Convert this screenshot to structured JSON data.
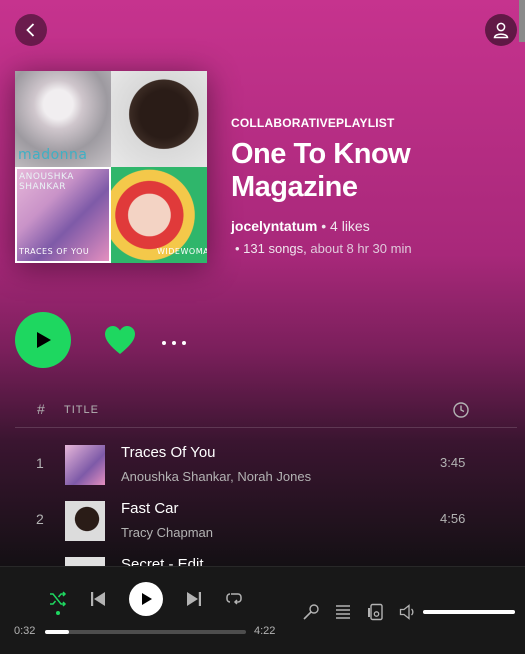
{
  "playlist": {
    "type_label": "COLLABORATIVEPLAYLIST",
    "title": "One To Know Magazine",
    "owner": "jocelyntatum",
    "likes": " • 4 likes",
    "song_count": "• 131 songs,",
    "duration": " about 8 hr 30 min"
  },
  "cover": {
    "tile1_text": "madonna",
    "tile3_text_top": "ANOUSHKA SHANKAR",
    "tile3_text_bottom": "TRACES OF YOU",
    "tile4_text": "WIDEWOMAN"
  },
  "table": {
    "num_header": "#",
    "title_header": "TITLE"
  },
  "tracks": [
    {
      "num": "1",
      "title": "Traces Of You",
      "artist": "Anoushka Shankar, Norah Jones",
      "duration": "3:45"
    },
    {
      "num": "2",
      "title": "Fast Car",
      "artist": "Tracy Chapman",
      "duration": "4:56"
    },
    {
      "num": "3",
      "title": "Secret - Edit",
      "artist": "",
      "duration": ""
    }
  ],
  "player": {
    "current_time": "0:32",
    "total_time": "4:22",
    "progress_fraction": 0.12,
    "volume_fraction": 1.0
  },
  "colors": {
    "accent": "#1ed760",
    "header_gradient_top": "#c6338e"
  },
  "icons": {
    "back": "chevron-left-icon",
    "user": "user-icon",
    "play": "play-icon",
    "heart": "heart-icon",
    "more": "more-icon",
    "clock": "clock-icon",
    "shuffle": "shuffle-icon",
    "prev": "skip-back-icon",
    "next": "skip-forward-icon",
    "repeat": "repeat-icon",
    "lyrics": "microphone-icon",
    "queue": "queue-icon",
    "device": "device-icon",
    "volume": "volume-icon"
  }
}
